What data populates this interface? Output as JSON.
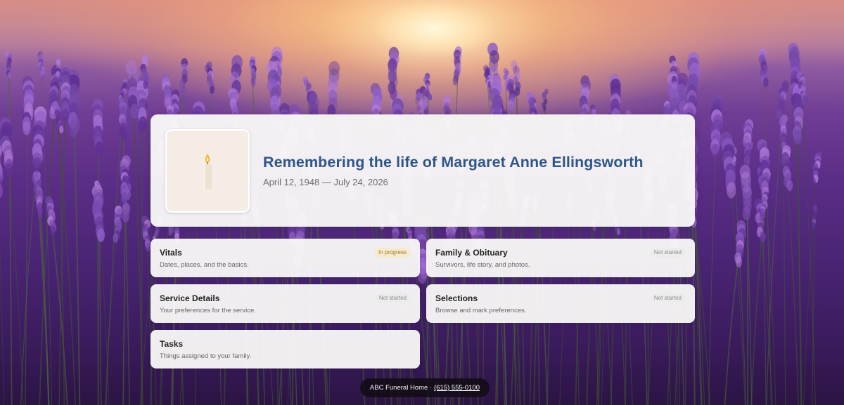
{
  "hero": {
    "title": "Remembering the life of Margaret Anne Ellingsworth",
    "dates": "April 12, 1948 — July 24, 2026",
    "portrait_icon": "candle-icon"
  },
  "cards": [
    {
      "id": "vitals",
      "title": "Vitals",
      "subtitle": "Dates, places, and the basics.",
      "status": "In progress"
    },
    {
      "id": "family",
      "title": "Family & Obituary",
      "subtitle": "Survivors, life story, and photos.",
      "status": "Not started"
    },
    {
      "id": "service",
      "title": "Service Details",
      "subtitle": "Your preferences for the service.",
      "status": "Not started"
    },
    {
      "id": "selections",
      "title": "Selections",
      "subtitle": "Browse and mark preferences.",
      "status": "Not started"
    },
    {
      "id": "tasks",
      "title": "Tasks",
      "subtitle": "Things assigned to your family."
    }
  ],
  "footer": {
    "business": "ABC Funeral Home ·",
    "phone": "(615) 555-0100"
  },
  "colors": {
    "title": "#2f5688",
    "badge_in_progress_bg": "#f6ebd0",
    "badge_in_progress_text": "#a27b22",
    "badge_not_started_bg": "#ececec",
    "badge_not_started_text": "#8b8b8b"
  }
}
